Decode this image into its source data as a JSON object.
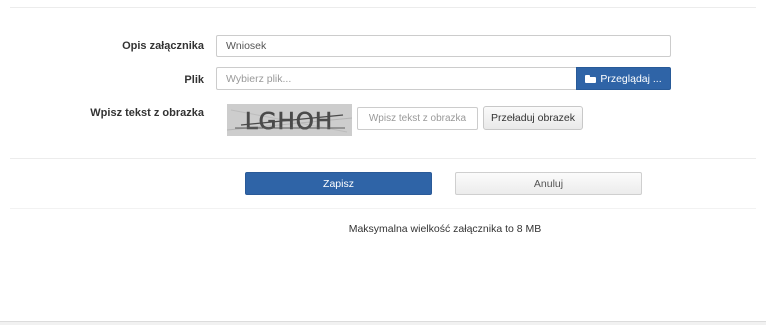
{
  "form": {
    "description": {
      "label": "Opis załącznika",
      "value": "Wniosek"
    },
    "file": {
      "label": "Plik",
      "placeholder": "Wybierz plik...",
      "browse_label": "Przeglądaj ...",
      "browse_icon": "folder-open-icon"
    },
    "captcha": {
      "label": "Wpisz tekst z obrazka",
      "image_text": "LGHOH",
      "input_placeholder": "Wpisz tekst z obrazka",
      "reload_label": "Przeładuj obrazek"
    },
    "actions": {
      "save_label": "Zapisz",
      "cancel_label": "Anuluj"
    },
    "note": "Maksymalna wielkość załącznika to 8 MB"
  },
  "colors": {
    "primary": "#2f64a7",
    "border": "#cccccc",
    "captcha_bg": "#cfcfcf"
  }
}
